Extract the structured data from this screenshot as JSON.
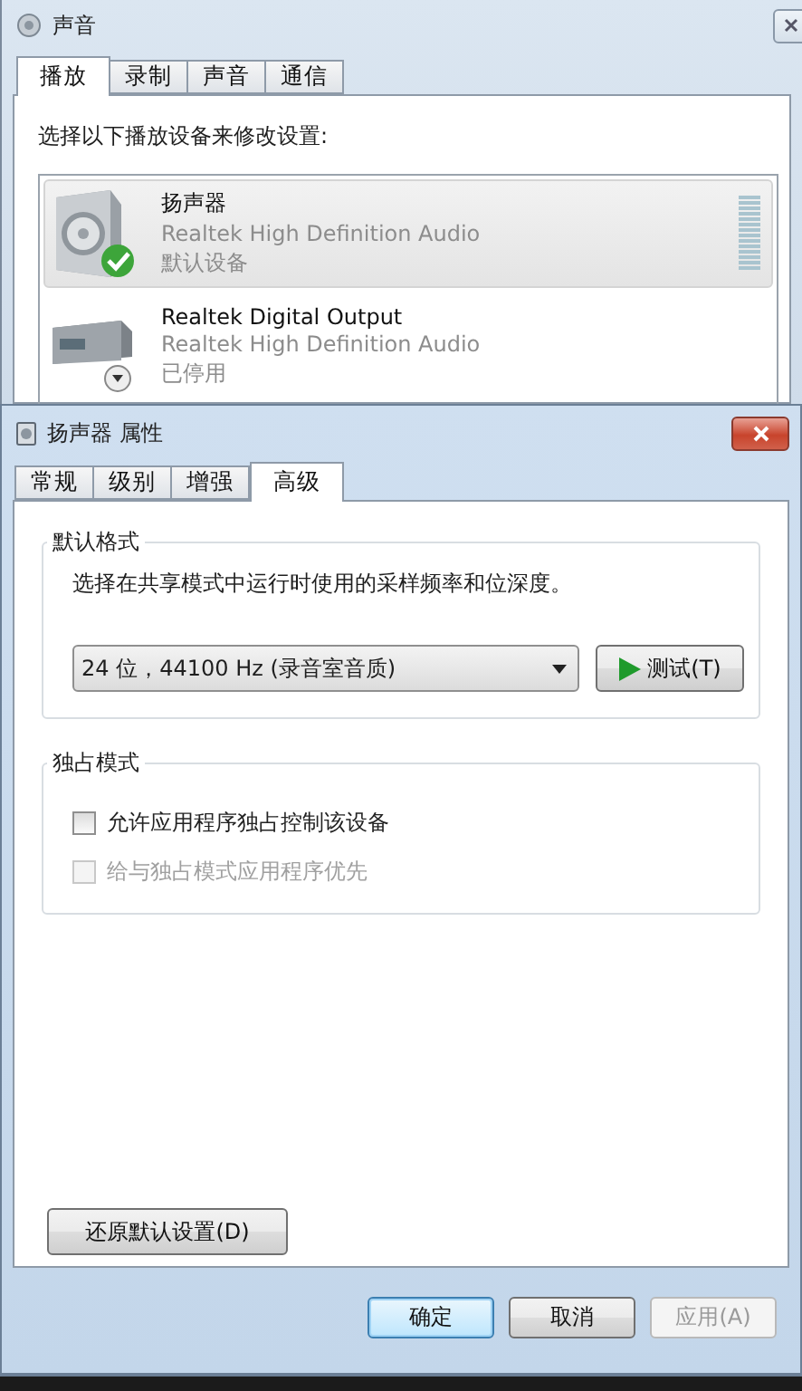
{
  "sound_window": {
    "title": "声音",
    "tabs": [
      {
        "label": "播放",
        "selected": true
      },
      {
        "label": "录制",
        "selected": false
      },
      {
        "label": "声音",
        "selected": false
      },
      {
        "label": "通信",
        "selected": false
      }
    ],
    "instruction": "选择以下播放设备来修改设置:",
    "devices": [
      {
        "kind": "speaker",
        "name": "扬声器",
        "driver": "Realtek High Definition Audio",
        "status": "默认设备",
        "default": true,
        "disabled": false,
        "selected": true
      },
      {
        "kind": "digital",
        "name": "Realtek Digital Output",
        "driver": "Realtek High Definition Audio",
        "status": "已停用",
        "default": false,
        "disabled": true,
        "selected": false
      }
    ]
  },
  "properties_window": {
    "title": "扬声器 属性",
    "tabs": [
      {
        "label": "常规",
        "selected": false
      },
      {
        "label": "级别",
        "selected": false
      },
      {
        "label": "增强",
        "selected": false
      },
      {
        "label": "高级",
        "selected": true
      }
    ],
    "default_format": {
      "title": "默认格式",
      "description": "选择在共享模式中运行时使用的采样频率和位深度。",
      "format": "24 位，44100 Hz (录音室音质)",
      "test_button": "测试(T)"
    },
    "exclusive_mode": {
      "title": "独占模式",
      "options": [
        {
          "label": "允许应用程序独占控制该设备",
          "checked": false,
          "disabled": false
        },
        {
          "label": "给与独占模式应用程序优先",
          "checked": false,
          "disabled": true
        }
      ]
    },
    "restore_button": "还原默认设置(D)",
    "buttons": [
      {
        "label": "确定",
        "default": true,
        "disabled": false
      },
      {
        "label": "取消",
        "default": false,
        "disabled": false
      },
      {
        "label": "应用(A)",
        "default": false,
        "disabled": true
      }
    ]
  }
}
